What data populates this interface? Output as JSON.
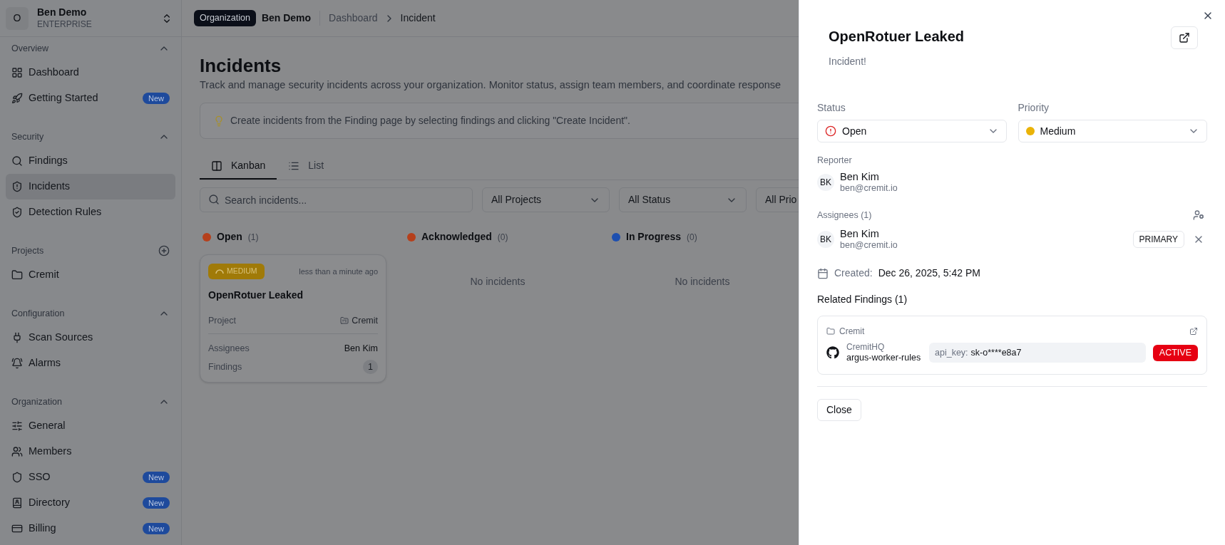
{
  "sidebar": {
    "org": {
      "initial": "O",
      "name": "Ben Demo",
      "plan": "ENTERPRISE"
    },
    "sections": [
      {
        "title": "Overview",
        "kind": "collapse",
        "items": [
          {
            "label": "Dashboard",
            "selected": false
          },
          {
            "label": "Getting Started",
            "badge": "New",
            "selected": false
          }
        ]
      },
      {
        "title": "Security",
        "kind": "collapse",
        "items": [
          {
            "label": "Findings",
            "selected": false
          },
          {
            "label": "Incidents",
            "selected": true
          },
          {
            "label": "Detection Rules",
            "selected": false
          }
        ]
      },
      {
        "title": "Projects",
        "kind": "add",
        "items": [
          {
            "label": "Cremit",
            "selected": false
          }
        ]
      },
      {
        "title": "Configuration",
        "kind": "collapse",
        "items": [
          {
            "label": "Scan Sources",
            "selected": false
          },
          {
            "label": "Alarms",
            "selected": false
          }
        ]
      },
      {
        "title": "Organization",
        "kind": "collapse",
        "items": [
          {
            "label": "General",
            "selected": false
          },
          {
            "label": "Members",
            "selected": false
          },
          {
            "label": "SSO",
            "badge": "New",
            "selected": false
          },
          {
            "label": "Directory",
            "badge": "New",
            "selected": false
          },
          {
            "label": "Billing",
            "badge": "New",
            "selected": false
          }
        ]
      }
    ]
  },
  "header": {
    "org_badge": "Organization",
    "org_name": "Ben Demo",
    "breadcrumbs": [
      "Dashboard",
      "Incident"
    ]
  },
  "page": {
    "title": "Incidents",
    "description": "Track and manage security incidents across your organization. Monitor status, assign team members, and coordinate response",
    "tip": "Create incidents from the Finding page by selecting findings and clicking \"Create Incident\".",
    "tabs": [
      {
        "label": "Kanban",
        "selected": true
      },
      {
        "label": "List",
        "selected": false
      }
    ],
    "search": {
      "placeholder": "Search incidents..."
    },
    "filters": [
      "All Projects",
      "All Status",
      "All Prio"
    ],
    "columns": [
      {
        "name": "Open",
        "count": "(1)",
        "color": "#b5401c",
        "cards": [
          {
            "priority": "MEDIUM",
            "kind": "medium",
            "time": "less than a minute ago",
            "title": "OpenRotuer Leaked",
            "fields": [
              {
                "label": "Project",
                "value": "Cremit",
                "kind": "project"
              },
              {
                "label": "Assignees",
                "value": "Ben Kim",
                "kind": "text"
              },
              {
                "label": "Findings",
                "value": "1",
                "kind": "count"
              }
            ]
          }
        ]
      },
      {
        "name": "Acknowledged",
        "count": "(0)",
        "color": "#b5401c",
        "empty_text": "No incidents"
      },
      {
        "name": "In Progress",
        "count": "(0)",
        "color": "#1d4fb0",
        "empty_text": "No incidents"
      }
    ]
  },
  "drawer": {
    "title": "OpenRotuer Leaked",
    "subtitle": "Incident!",
    "status": {
      "label": "Status",
      "value": "Open",
      "kind": "open"
    },
    "priority": {
      "label": "Priority",
      "value": "Medium",
      "kind": "medium"
    },
    "reporter": {
      "label": "Reporter",
      "initials": "BK",
      "name": "Ben Kim",
      "email": "ben@cremit.io"
    },
    "assignees": {
      "label": "Assignees (1)",
      "items": [
        {
          "initials": "BK",
          "name": "Ben Kim",
          "email": "ben@cremit.io",
          "role": "PRIMARY"
        }
      ]
    },
    "created": {
      "label": "Created:",
      "value": "Dec 26, 2025, 5:42 PM"
    },
    "related": {
      "title": "Related Findings (1)",
      "items": [
        {
          "project": "Cremit",
          "owner": "CremitHQ",
          "repo": "argus-worker-rules",
          "key_label": "api_key:",
          "key_value": "sk-o****e8a7",
          "status": "ACTIVE"
        }
      ]
    },
    "close_button": "Close"
  }
}
